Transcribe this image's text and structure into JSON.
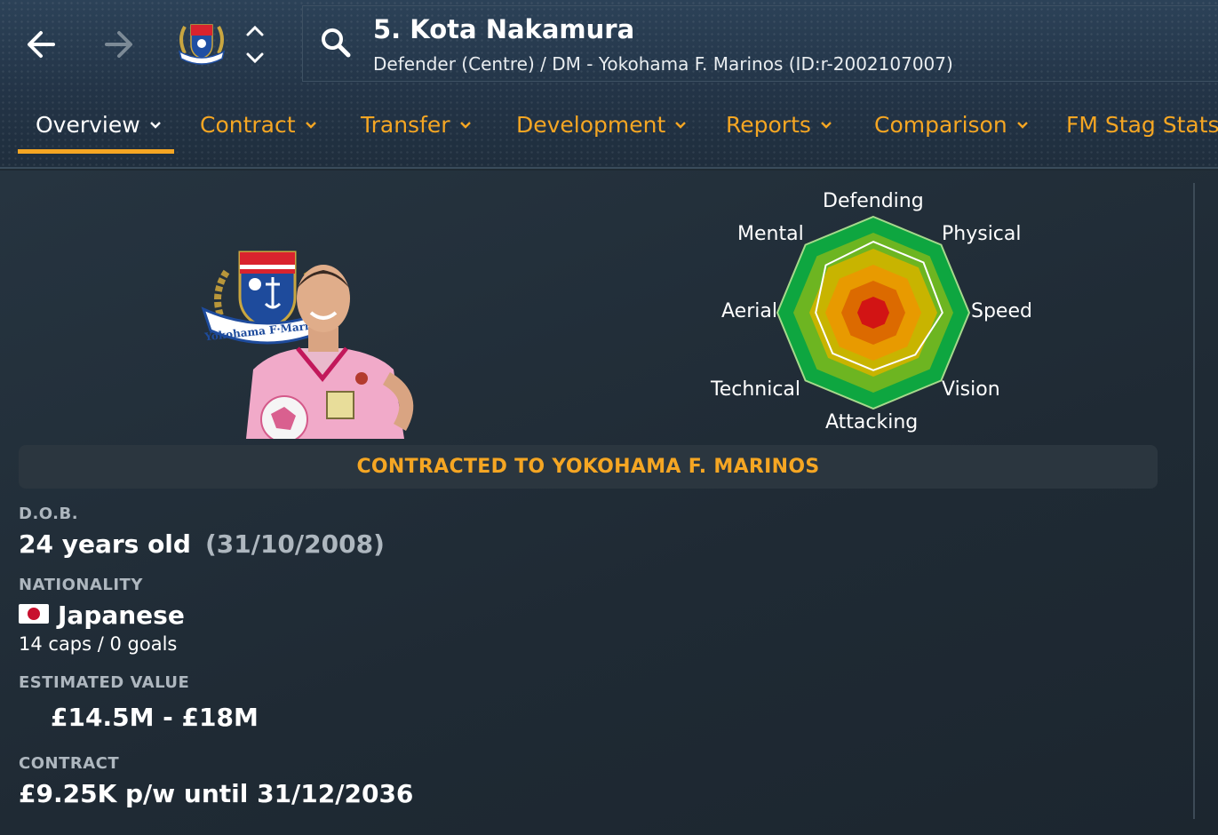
{
  "header": {
    "player_title": "5. Kota Nakamura",
    "player_subtitle": "Defender (Centre) / DM - Yokohama F. Marinos (ID:r-2002107007)",
    "back_icon": "arrow-left-icon",
    "forward_icon": "arrow-right-icon",
    "search_icon": "search-icon",
    "club_badge_text": "Yokohama F·Marinos"
  },
  "tabs": [
    {
      "label": "Overview",
      "active": true
    },
    {
      "label": "Contract"
    },
    {
      "label": "Transfer"
    },
    {
      "label": "Development"
    },
    {
      "label": "Reports"
    },
    {
      "label": "Comparison"
    },
    {
      "label": "FM Stag Stats"
    }
  ],
  "radar": {
    "axes": [
      "Defending",
      "Physical",
      "Speed",
      "Vision",
      "Attacking",
      "Technical",
      "Aerial",
      "Mental"
    ],
    "colors": [
      "#0ea640",
      "#6db521",
      "#c8b400",
      "#e89a00",
      "#dc6a00",
      "#d21414"
    ]
  },
  "banner": {
    "text": "CONTRACTED TO YOKOHAMA F. MARINOS"
  },
  "details": {
    "dob_label": "D.O.B.",
    "age": "24 years old",
    "dob": "(31/10/2008)",
    "nationality_label": "NATIONALITY",
    "nationality": "Japanese",
    "caps": "14 caps / 0 goals",
    "value_label": "ESTIMATED VALUE",
    "value": "£14.5M - £18M",
    "contract_label": "CONTRACT",
    "contract": "£9.25K p/w until 31/12/2036"
  },
  "accent_color": "#f5a623"
}
